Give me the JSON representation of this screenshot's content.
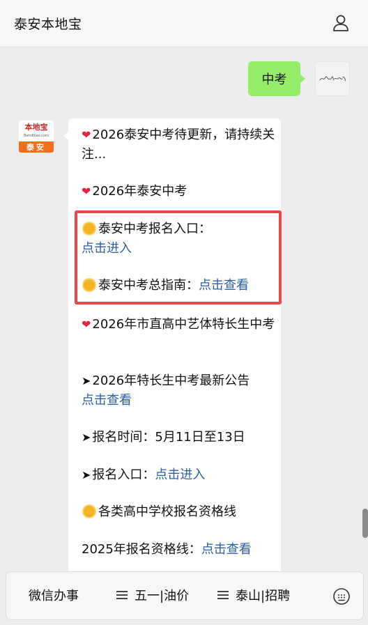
{
  "header": {
    "title": "泰安本地宝",
    "profile_icon": "person-icon"
  },
  "user_message": {
    "text": "中考"
  },
  "bot_avatar": {
    "name": "本地宝",
    "domain": "Bendibao.com",
    "city": "泰安"
  },
  "bot_message": {
    "line1": "2026泰安中考待更新，请持续关注...",
    "line2": "2026年泰安中考",
    "line3_text": "泰安中考报名入口：",
    "line3_link": "点击进入",
    "line4_text": "泰安中考总指南：",
    "line4_link": "点击查看",
    "line5": "2026年市直高中艺体特长生中考",
    "line6_text": "2026年特长生中考最新公告",
    "line6_link": "点击查看",
    "line7": "报名时间：5月11日至13日",
    "line8_text": "报名入口：",
    "line8_link": "点击进入",
    "line9": "各类高中学校报名资格线",
    "line10_text": "2025年报名资格线：",
    "line10_link": "点击查看"
  },
  "menu": {
    "item1": "微信办事",
    "item2": "五一|油价",
    "item3": "泰山|招聘",
    "keyboard_icon": "keyboard-icon"
  },
  "colors": {
    "user_bubble": "#95ec69",
    "link": "#2a5fa8",
    "highlight": "#e84848",
    "background": "#ededed"
  }
}
